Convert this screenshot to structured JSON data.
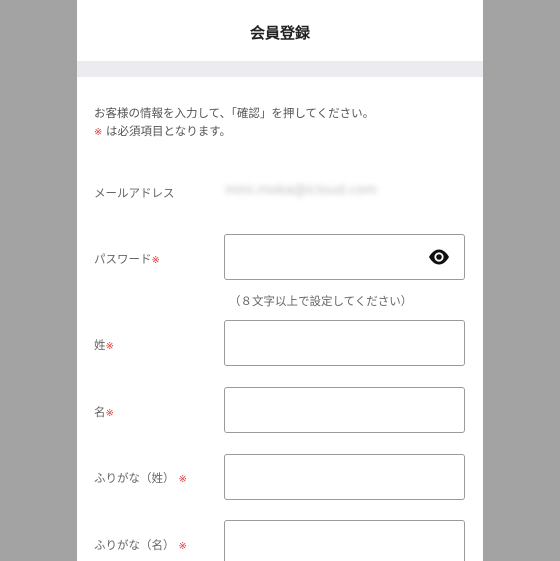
{
  "form": {
    "title": "会員登録",
    "intro_line1": "お客様の情報を入力して、「確認」を押してください。",
    "intro_required_mark": "※",
    "intro_line2": "は必須項目となります。",
    "required_mark": "※",
    "email_label": "メールアドレス",
    "email_value": "mini.moka@icloud.com",
    "password_label": "パスワード",
    "password_value": "",
    "password_hint": "（８文字以上で設定してください）",
    "last_name_label": "姓",
    "last_name_value": "",
    "first_name_label": "名",
    "first_name_value": "",
    "last_name_kana_label": "ふりがな（姓）",
    "last_name_kana_value": "",
    "first_name_kana_label": "ふりがな（名）",
    "first_name_kana_value": "",
    "eye_icon": "show-password-eye-icon"
  }
}
